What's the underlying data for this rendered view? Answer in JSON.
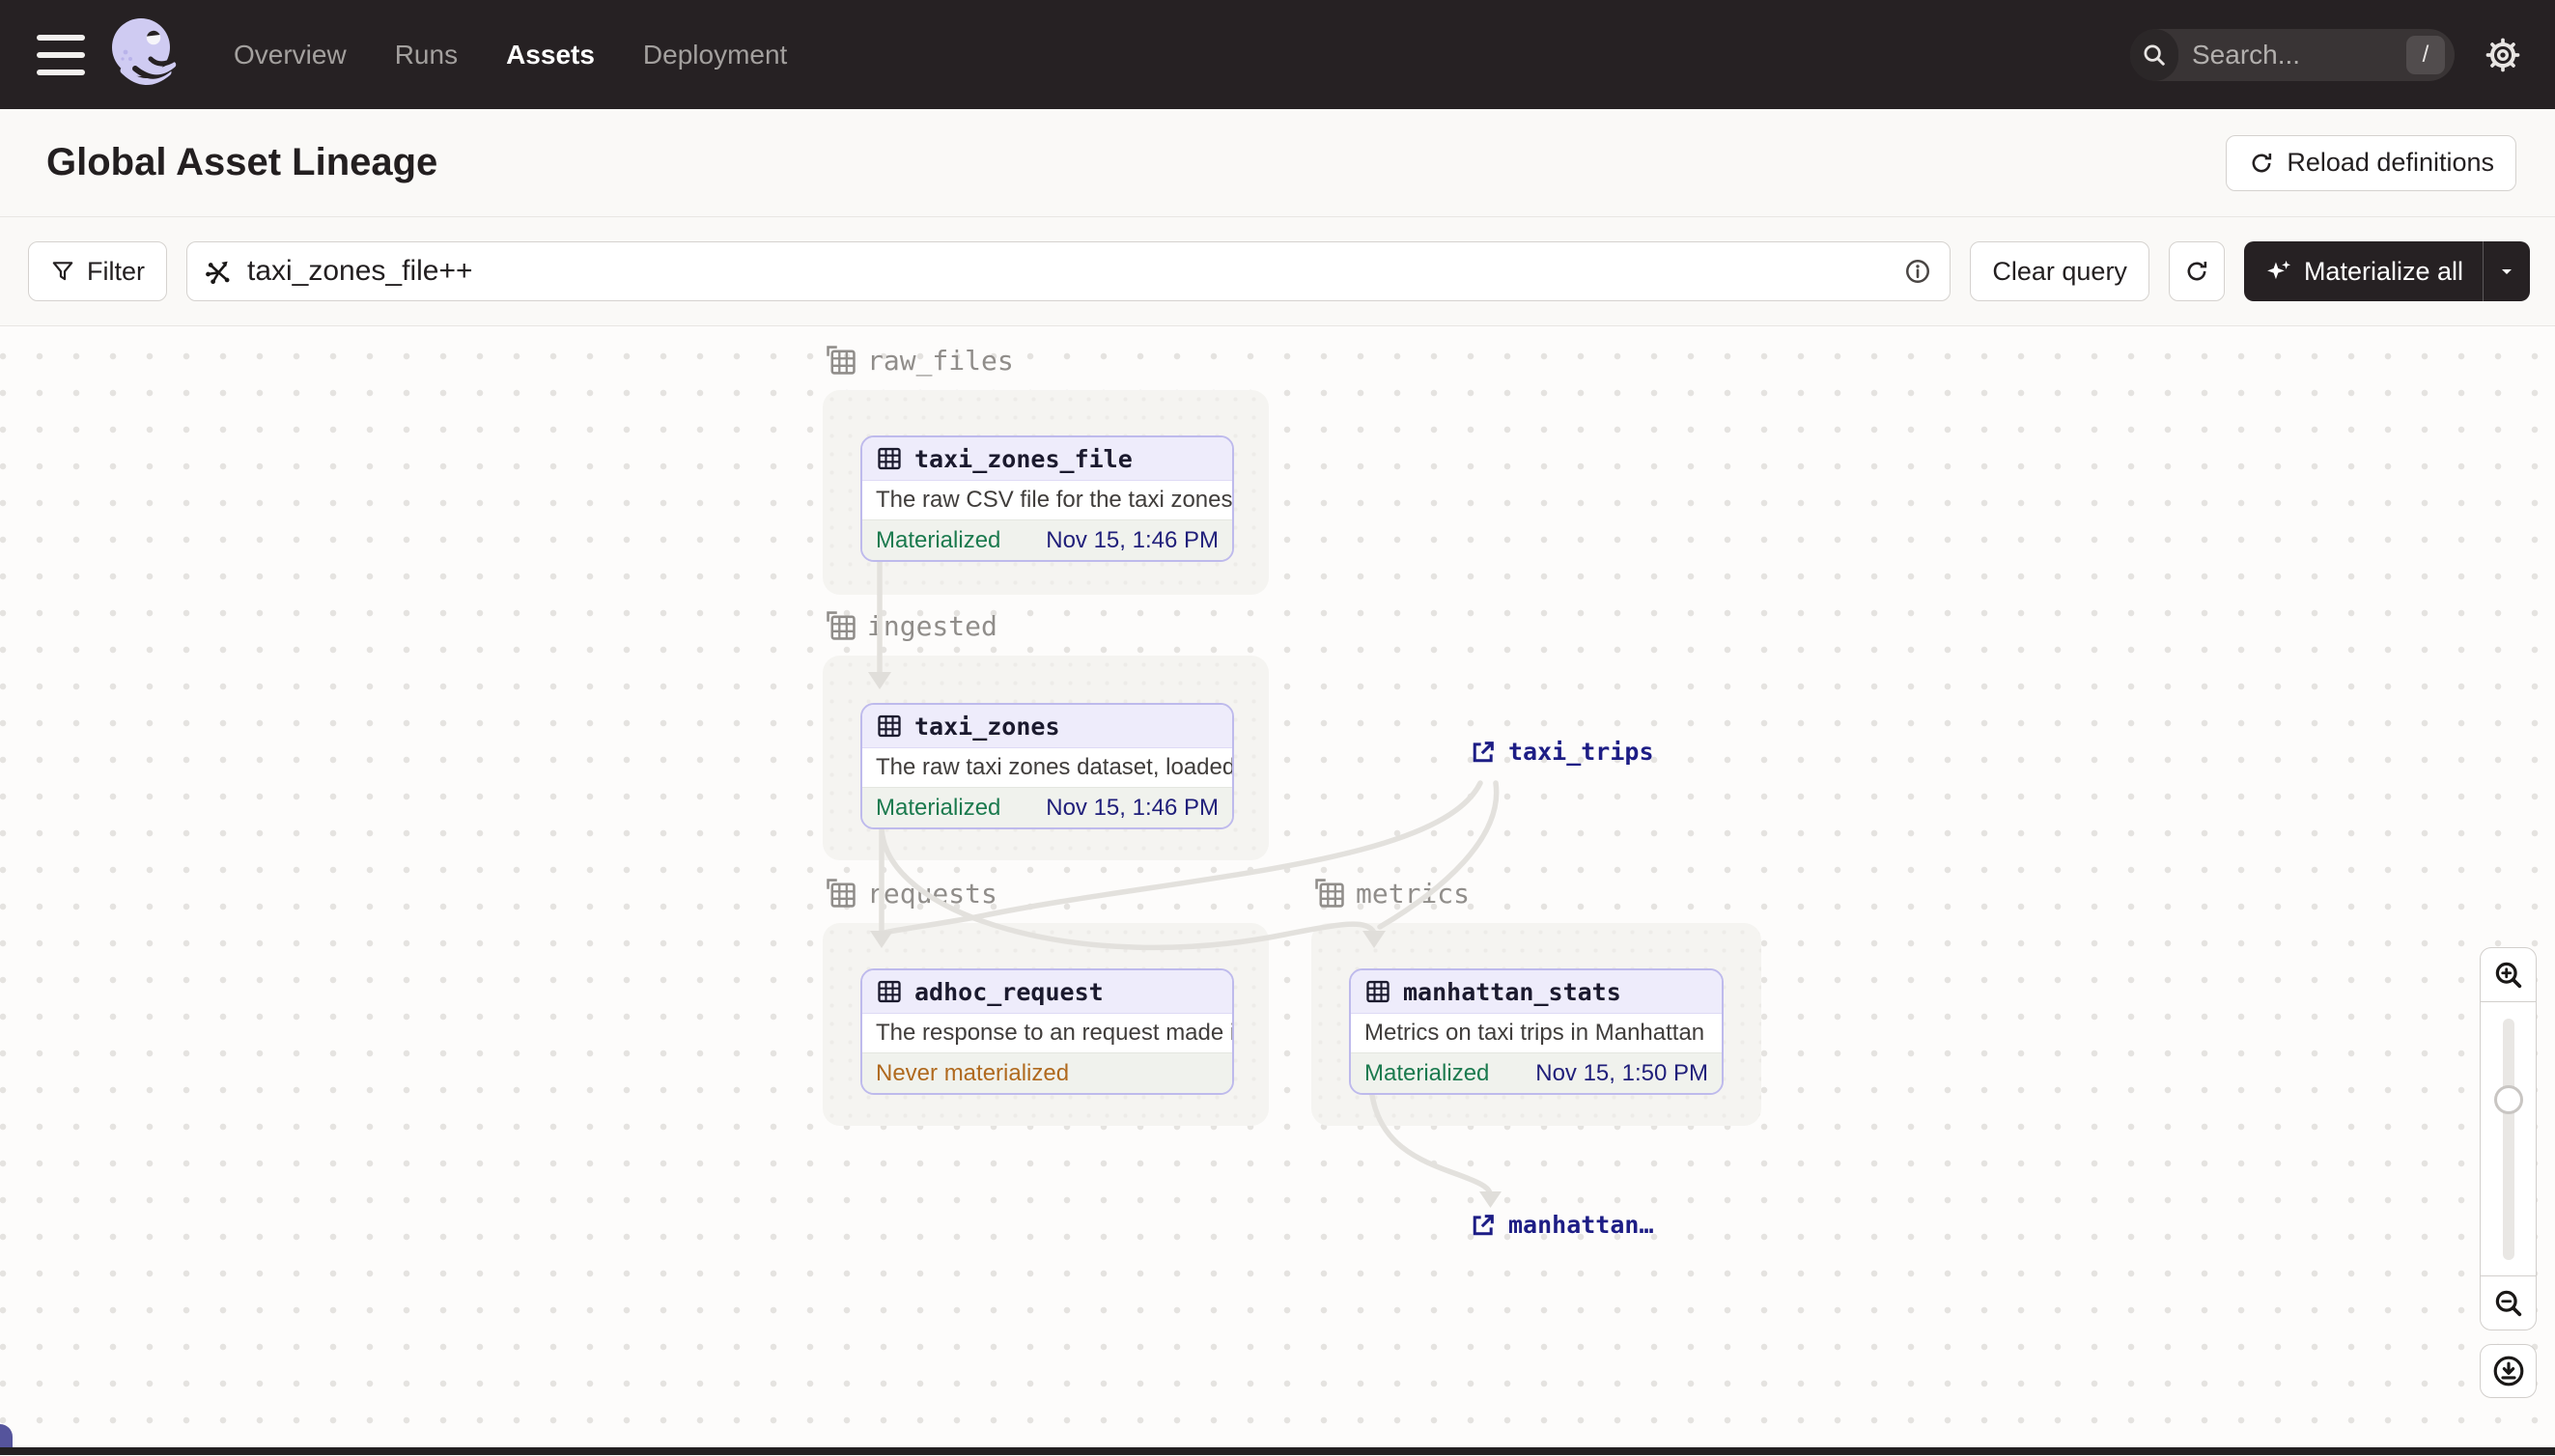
{
  "nav": {
    "tabs": [
      {
        "label": "Overview",
        "active": false
      },
      {
        "label": "Runs",
        "active": false
      },
      {
        "label": "Assets",
        "active": true
      },
      {
        "label": "Deployment",
        "active": false
      }
    ],
    "search_placeholder": "Search...",
    "search_shortcut": "/"
  },
  "header": {
    "title": "Global Asset Lineage",
    "reload_label": "Reload definitions"
  },
  "toolbar": {
    "filter_label": "Filter",
    "query_value": "taxi_zones_file++",
    "clear_label": "Clear query",
    "materialize_label": "Materialize all"
  },
  "graph": {
    "groups": [
      {
        "name": "raw_files"
      },
      {
        "name": "ingested"
      },
      {
        "name": "requests"
      },
      {
        "name": "metrics"
      }
    ],
    "nodes": [
      {
        "title": "taxi_zones_file",
        "description": "The raw CSV file for the taxi zones dat...",
        "status": "Materialized",
        "timestamp": "Nov 15, 1:46 PM"
      },
      {
        "title": "taxi_zones",
        "description": "The raw taxi zones dataset, loaded int...",
        "status": "Materialized",
        "timestamp": "Nov 15, 1:46 PM"
      },
      {
        "title": "adhoc_request",
        "description": "The response to an request made in th...",
        "status": "Never materialized",
        "timestamp": ""
      },
      {
        "title": "manhattan_stats",
        "description": "Metrics on taxi trips in Manhattan",
        "status": "Materialized",
        "timestamp": "Nov 15, 1:50 PM"
      }
    ],
    "external_assets": [
      {
        "label": "taxi_trips"
      },
      {
        "label": "manhattan…"
      }
    ]
  },
  "colors": {
    "nav_bg": "#262123",
    "accent_lavender": "#BEBAEC",
    "status_green": "#1B7A4E",
    "status_orange": "#B06A1F",
    "timestamp_navy": "#201F7A",
    "edge_gray": "#E3E1DD"
  }
}
